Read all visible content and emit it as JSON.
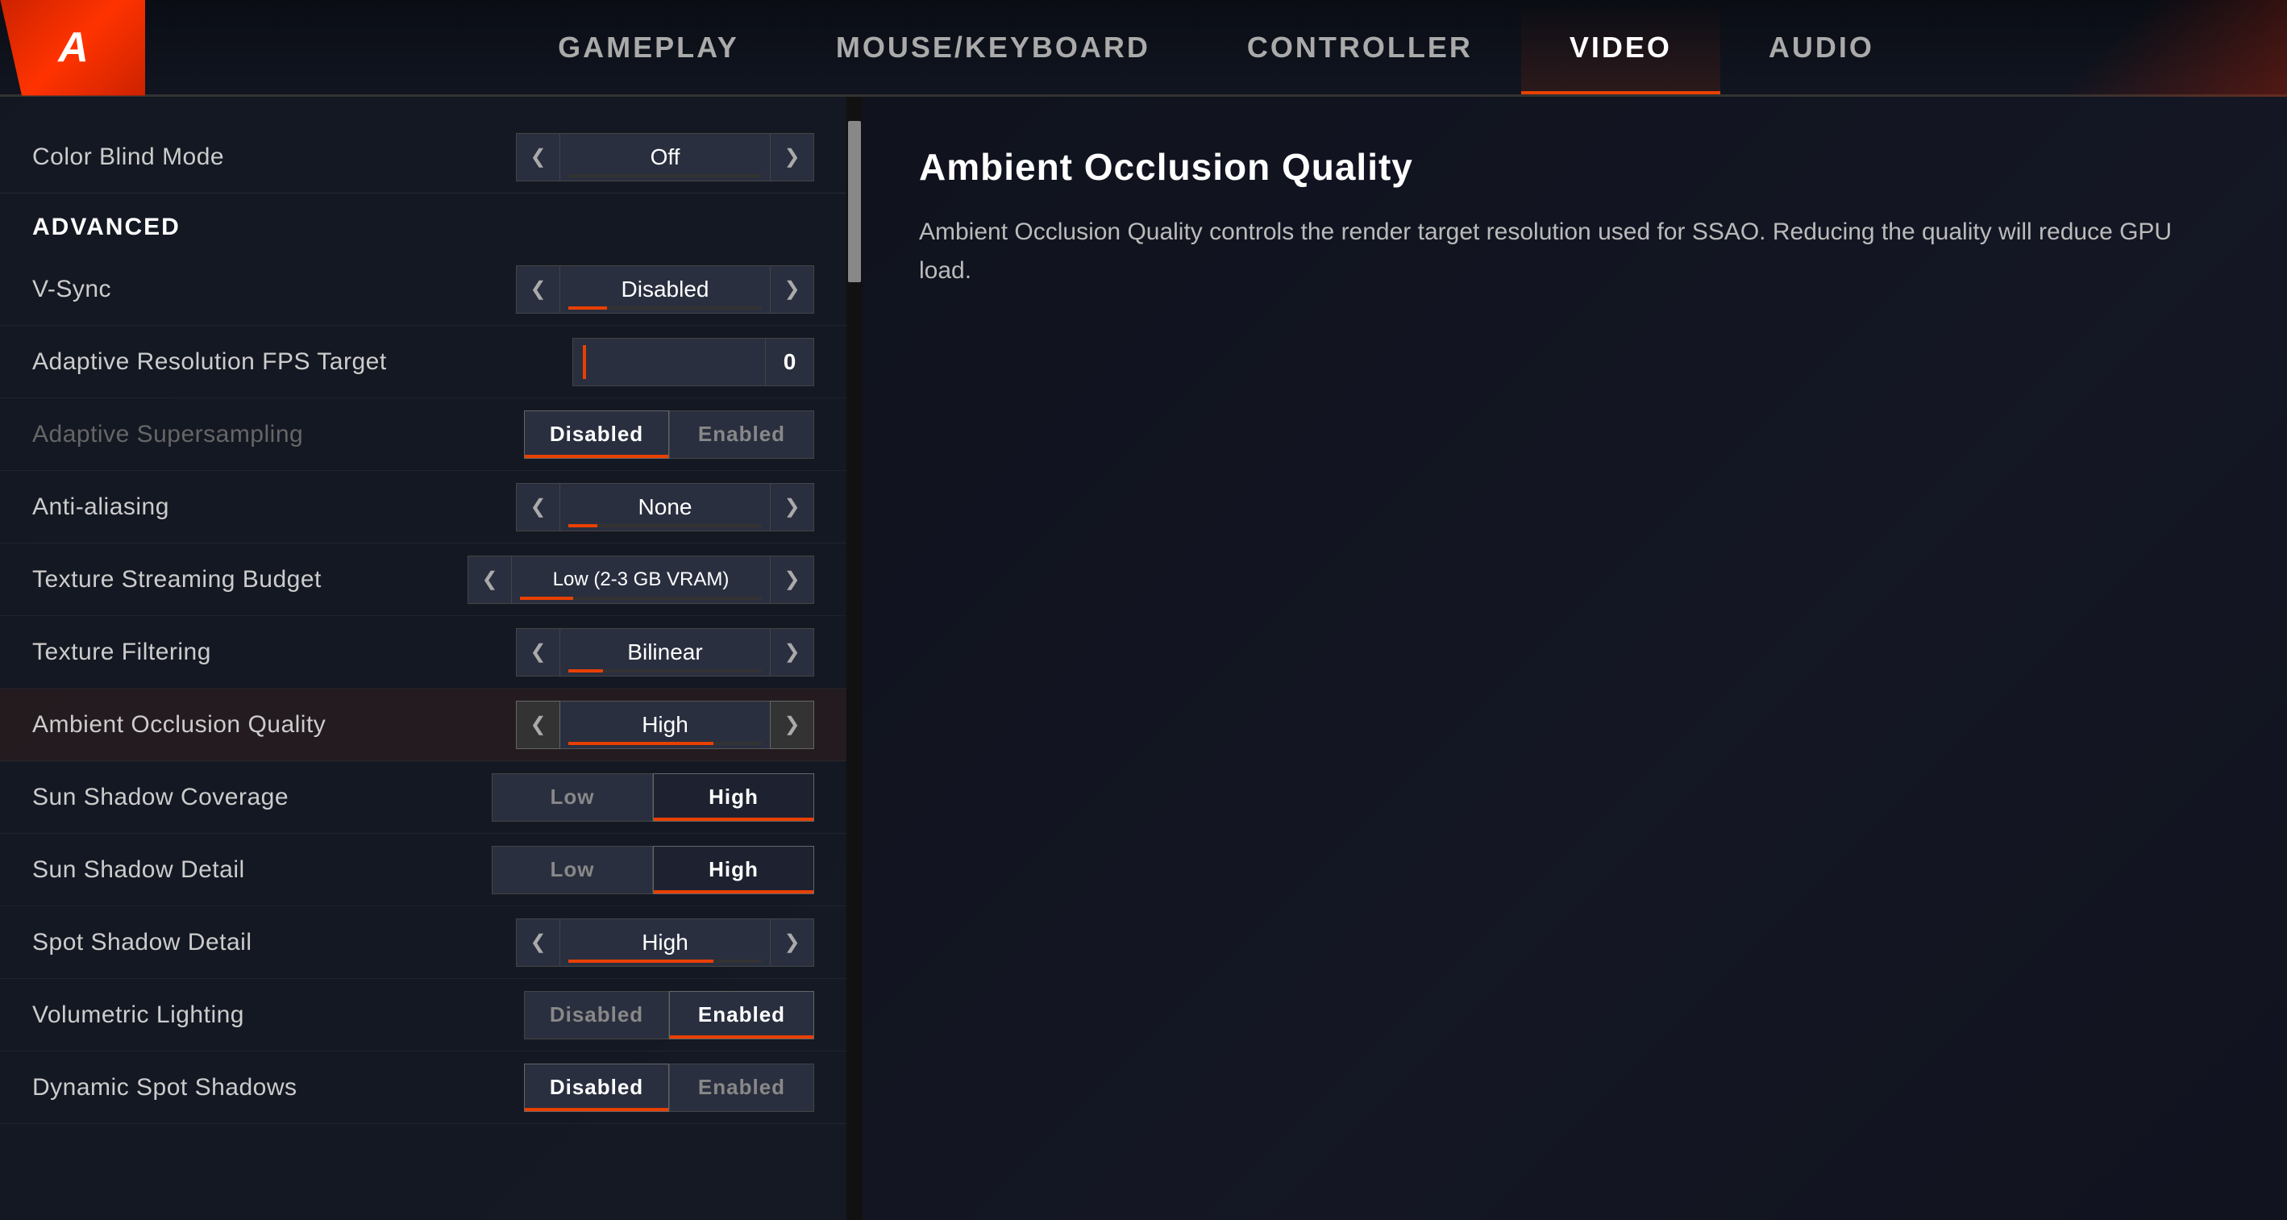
{
  "logo": {
    "text": "A"
  },
  "nav": {
    "tabs": [
      {
        "id": "gameplay",
        "label": "GAMEPLAY",
        "active": false
      },
      {
        "id": "mouse-keyboard",
        "label": "MOUSE/KEYBOARD",
        "active": false
      },
      {
        "id": "controller",
        "label": "CONTROLLER",
        "active": false
      },
      {
        "id": "video",
        "label": "VIDEO",
        "active": true
      },
      {
        "id": "audio",
        "label": "AUDIO",
        "active": false
      }
    ]
  },
  "settings": {
    "color_blind_label": "Color Blind Mode",
    "color_blind_value": "Off",
    "color_blind_bar_pct": 0,
    "section_advanced": "ADVANCED",
    "rows": [
      {
        "id": "vsync",
        "label": "V-Sync",
        "control": "arrow",
        "value": "Disabled",
        "bar_pct": 20,
        "active": false
      },
      {
        "id": "adaptive-res",
        "label": "Adaptive Resolution FPS Target",
        "control": "fps",
        "value": "0",
        "active": false
      },
      {
        "id": "adaptive-supersampling",
        "label": "Adaptive Supersampling",
        "control": "toggle",
        "options": [
          "Disabled",
          "Enabled"
        ],
        "active_option": 0,
        "dimmed": true
      },
      {
        "id": "anti-aliasing",
        "label": "Anti-aliasing",
        "control": "arrow",
        "value": "None",
        "bar_pct": 15,
        "active": false
      },
      {
        "id": "texture-streaming",
        "label": "Texture Streaming Budget",
        "control": "arrow",
        "value": "Low (2-3 GB VRAM)",
        "bar_pct": 22,
        "active": false
      },
      {
        "id": "texture-filtering",
        "label": "Texture Filtering",
        "control": "arrow",
        "value": "Bilinear",
        "bar_pct": 18,
        "active": false
      },
      {
        "id": "ambient-occlusion",
        "label": "Ambient Occlusion Quality",
        "control": "arrow",
        "value": "High",
        "bar_pct": 75,
        "active": true
      },
      {
        "id": "sun-shadow-coverage",
        "label": "Sun Shadow Coverage",
        "control": "lowhigh",
        "options": [
          "Low",
          "High"
        ],
        "active_option": 1
      },
      {
        "id": "sun-shadow-detail",
        "label": "Sun Shadow Detail",
        "control": "lowhigh",
        "options": [
          "Low",
          "High"
        ],
        "active_option": 1
      },
      {
        "id": "spot-shadow-detail",
        "label": "Spot Shadow Detail",
        "control": "arrow",
        "value": "High",
        "bar_pct": 75,
        "active": false
      },
      {
        "id": "volumetric-lighting",
        "label": "Volumetric Lighting",
        "control": "toggle",
        "options": [
          "Disabled",
          "Enabled"
        ],
        "active_option": 1
      },
      {
        "id": "dynamic-spot-shadows",
        "label": "Dynamic Spot Shadows",
        "control": "toggle",
        "options": [
          "Disabled",
          "Enabled"
        ],
        "active_option": 0
      }
    ]
  },
  "info_panel": {
    "title": "Ambient Occlusion Quality",
    "description": "Ambient Occlusion Quality controls the render target resolution used for SSAO. Reducing the quality will reduce GPU load."
  },
  "icons": {
    "chevron_left": "❮",
    "chevron_right": "❯"
  }
}
